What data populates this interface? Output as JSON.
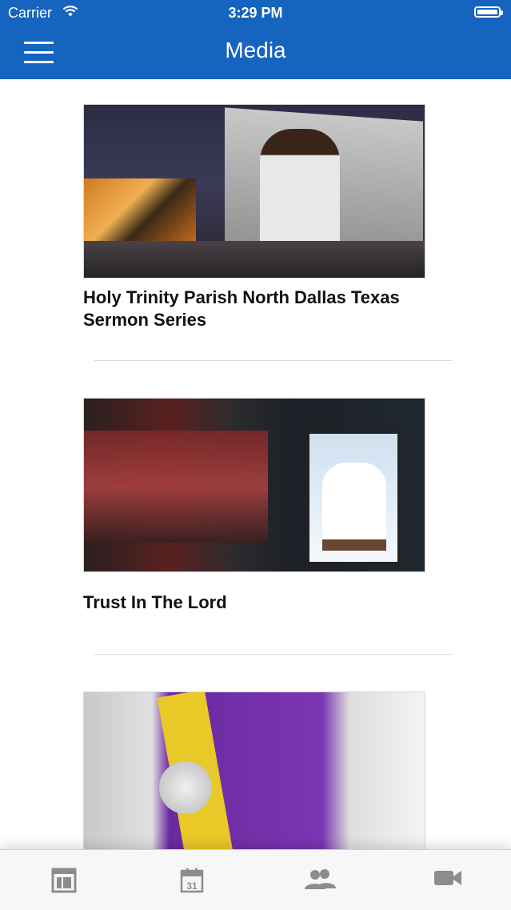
{
  "status_bar": {
    "carrier": "Carrier",
    "time": "3:29 PM"
  },
  "nav_bar": {
    "title": "Media",
    "menu_icon": "hamburger-icon"
  },
  "media_items": [
    {
      "title": "Holy Trinity Parish North Dallas Texas Sermon Series"
    },
    {
      "title": "Trust In The Lord"
    },
    {
      "title": ""
    }
  ],
  "tab_bar": {
    "tabs": [
      {
        "icon": "layout-icon"
      },
      {
        "icon": "calendar-icon",
        "label": "31"
      },
      {
        "icon": "people-icon"
      },
      {
        "icon": "video-camera-icon"
      }
    ]
  },
  "colors": {
    "header": "#1565c0",
    "icon_gray": "#8c8c8c"
  }
}
